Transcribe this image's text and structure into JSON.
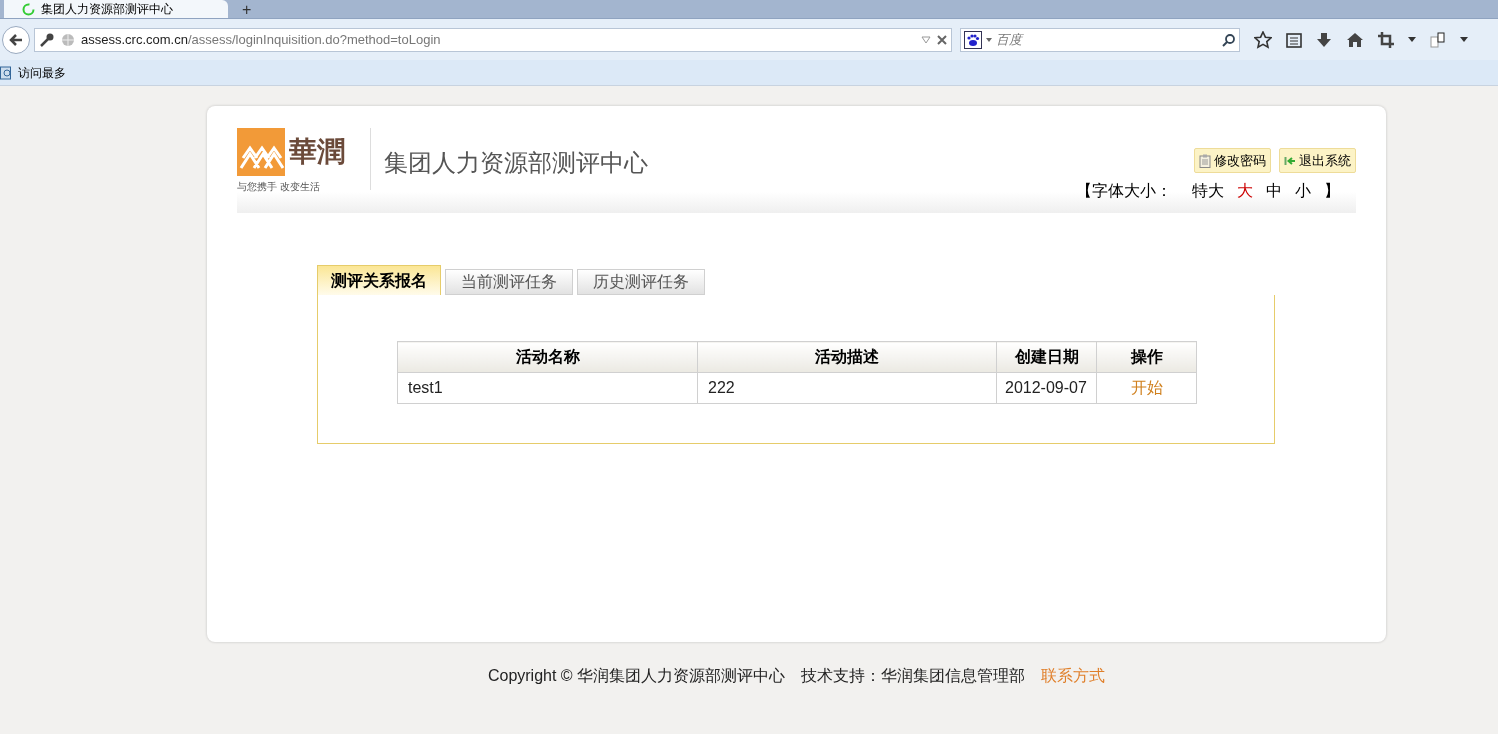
{
  "browser": {
    "tab_title": "集团人力资源部测评中心",
    "new_tab": "+",
    "url_host": "assess.crc.com.cn",
    "url_path": "/assess/loginInquisition.do?method=toLogin",
    "search_placeholder": "百度",
    "bookmarks": [
      "访问最多"
    ]
  },
  "header": {
    "logo_text": "華潤",
    "logo_tagline": "与您携手 改变生活",
    "title": "集团人力资源部测评中心",
    "buttons": [
      {
        "kind": "password",
        "label": "修改密码"
      },
      {
        "kind": "logout",
        "label": "退出系统"
      }
    ],
    "font_size": {
      "open": "【",
      "label": "字体大小：",
      "options": [
        {
          "label": "特大",
          "selected": false
        },
        {
          "label": "大",
          "selected": true
        },
        {
          "label": "中",
          "selected": false
        },
        {
          "label": "小",
          "selected": false
        }
      ],
      "close": "】"
    }
  },
  "tabs": [
    {
      "label": "测评关系报名",
      "selected": true
    },
    {
      "label": "当前测评任务",
      "selected": false
    },
    {
      "label": "历史测评任务",
      "selected": false
    }
  ],
  "table": {
    "columns": [
      "活动名称",
      "活动描述",
      "创建日期",
      "操作"
    ],
    "rows": [
      {
        "name": "test1",
        "description": "222",
        "date": "2012-09-07",
        "action": "开始"
      }
    ]
  },
  "footer": {
    "copyright": "Copyright © 华润集团人力资源部测评中心",
    "support": "技术支持：华润集团信息管理部",
    "contact": "联系方式"
  }
}
